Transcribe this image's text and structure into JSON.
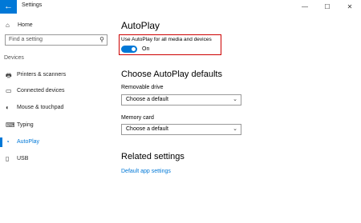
{
  "window": {
    "title": "Settings",
    "controls": {
      "minimize": "—",
      "maximize": "☐",
      "close": "✕"
    },
    "back_icon": "←"
  },
  "sidebar": {
    "home": {
      "label": "Home",
      "icon": "⌂"
    },
    "search": {
      "placeholder": "Find a setting",
      "icon": "⚲"
    },
    "section_label": "Devices",
    "items": [
      {
        "label": "Printers & scanners",
        "icon": "🖶",
        "active": false
      },
      {
        "label": "Connected devices",
        "icon": "▭",
        "active": false
      },
      {
        "label": "Mouse & touchpad",
        "icon": "◐",
        "active": false
      },
      {
        "label": "Typing",
        "icon": "⌨",
        "active": false
      },
      {
        "label": "AutoPlay",
        "icon": "◔",
        "active": true
      },
      {
        "label": "USB",
        "icon": "▯",
        "active": false
      }
    ],
    "accent": "#0078d7"
  },
  "main": {
    "title": "AutoPlay",
    "toggle": {
      "label": "Use AutoPlay for all media and devices",
      "state": "On",
      "on": true
    },
    "defaults_heading": "Choose AutoPlay defaults",
    "removable_drive": {
      "label": "Removable drive",
      "value": "Choose a default"
    },
    "memory_card": {
      "label": "Memory card",
      "value": "Choose a default"
    },
    "related_heading": "Related settings",
    "related_link": "Default app settings",
    "highlight_color": "#cc0000"
  }
}
